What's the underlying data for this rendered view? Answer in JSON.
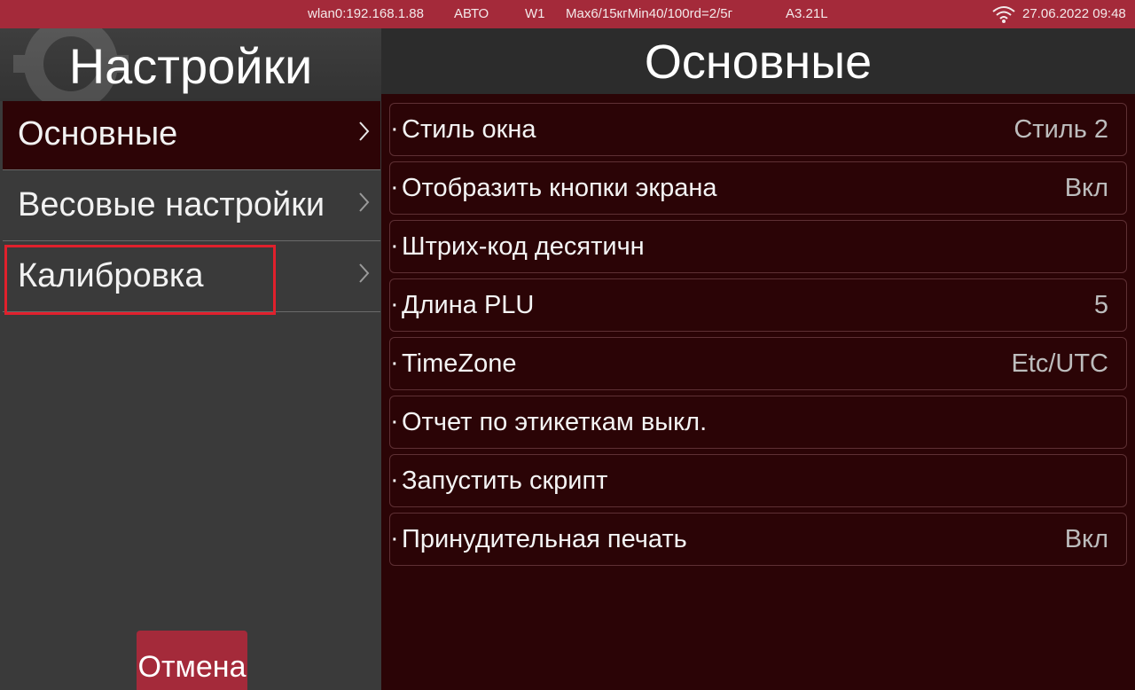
{
  "status_bar": {
    "network": "wlan0:192.168.1.88",
    "mode": "АВТО",
    "weigh_range": "W1",
    "capacity": "Max6/15кгMin40/100rd=2/5г",
    "version": "A3.21L",
    "datetime": "27.06.2022 09:48",
    "icon": "wifi-icon"
  },
  "sidebar": {
    "title": "Настройки",
    "items": [
      {
        "label": "Основные",
        "selected": true
      },
      {
        "label": "Весовые настройки",
        "selected": false
      },
      {
        "label": "Калибровка",
        "selected": false,
        "highlighted": true
      }
    ],
    "cancel_label": "Отмена"
  },
  "main": {
    "title": "Основные",
    "rows": [
      {
        "label": "Стиль окна",
        "value": "Стиль 2"
      },
      {
        "label": "Отобразить кнопки экрана",
        "value": "Вкл"
      },
      {
        "label": "Штрих-код десятичн",
        "value": ""
      },
      {
        "label": "Длина PLU",
        "value": "5"
      },
      {
        "label": "TimeZone",
        "value": "Etc/UTC"
      },
      {
        "label": "Отчет по этикеткам выкл.",
        "value": ""
      },
      {
        "label": "Запустить скрипт",
        "value": ""
      },
      {
        "label": "Принудительная печать",
        "value": "Вкл"
      }
    ]
  },
  "colors": {
    "status_bar": "#a42a3a",
    "selection_dark": "#2d0406",
    "highlight_border": "#e0202c"
  }
}
